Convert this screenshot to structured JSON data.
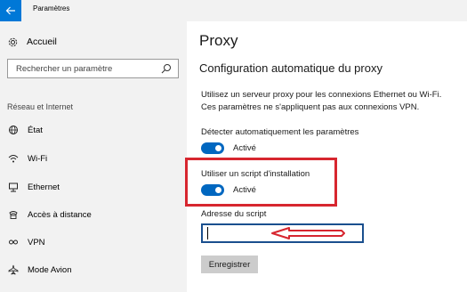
{
  "window": {
    "title": "Paramètres"
  },
  "sidebar": {
    "home_label": "Accueil",
    "search_placeholder": "Rechercher un paramètre",
    "section_title": "Réseau et Internet",
    "items": [
      {
        "label": "État",
        "icon": "globe-icon"
      },
      {
        "label": "Wi-Fi",
        "icon": "wifi-icon"
      },
      {
        "label": "Ethernet",
        "icon": "ethernet-icon"
      },
      {
        "label": "Accès à distance",
        "icon": "dialup-icon"
      },
      {
        "label": "VPN",
        "icon": "vpn-icon"
      },
      {
        "label": "Mode Avion",
        "icon": "airplane-icon"
      }
    ]
  },
  "main": {
    "title": "Proxy",
    "subtitle": "Configuration automatique du proxy",
    "description_line1": "Utilisez un serveur proxy pour les connexions Ethernet ou Wi-Fi.",
    "description_line2": "Ces paramètres ne s'appliquent pas aux connexions VPN.",
    "auto_detect": {
      "label": "Détecter automatiquement les paramètres",
      "state": "Activé",
      "on": true
    },
    "use_script": {
      "label": "Utiliser un script d'installation",
      "state": "Activé",
      "on": true
    },
    "script_address": {
      "label": "Adresse du script",
      "value": ""
    },
    "save_label": "Enregistrer"
  },
  "colors": {
    "accent": "#0078d7",
    "toggle": "#0067c0",
    "annotation": "#d7262f",
    "sidebar_bg": "#f2f2f2"
  }
}
